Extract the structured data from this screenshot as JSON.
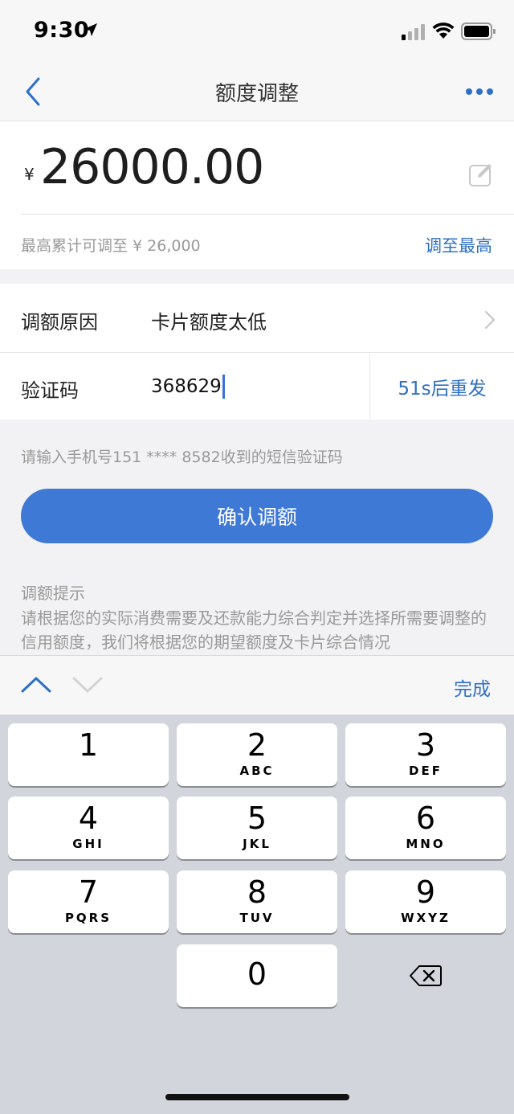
{
  "status_bar": {
    "time": "9:30"
  },
  "nav": {
    "title": "额度调整"
  },
  "amount": {
    "currency": "¥",
    "value": "26000.00",
    "max_hint": "最高累计可调至 ¥ 26,000",
    "adjust_max_label": "调至最高"
  },
  "form": {
    "reason_label": "调额原因",
    "reason_value": "卡片额度太低",
    "code_label": "验证码",
    "code_value": "368629",
    "resend_label": "51s后重发"
  },
  "sms_hint": "请输入手机号151 **** 8582收到的短信验证码",
  "confirm_label": "确认调额",
  "tips": {
    "title": "调额提示",
    "body": "请根据您的实际消费需要及还款能力综合判定并选择所需要调整的信用额度，我们将根据您的期望额度及卡片综合情况"
  },
  "keyboard": {
    "done_label": "完成",
    "keys": [
      {
        "digit": "1",
        "letters": ""
      },
      {
        "digit": "2",
        "letters": "ABC"
      },
      {
        "digit": "3",
        "letters": "DEF"
      },
      {
        "digit": "4",
        "letters": "GHI"
      },
      {
        "digit": "5",
        "letters": "JKL"
      },
      {
        "digit": "6",
        "letters": "MNO"
      },
      {
        "digit": "7",
        "letters": "PQRS"
      },
      {
        "digit": "8",
        "letters": "TUV"
      },
      {
        "digit": "9",
        "letters": "WXYZ"
      },
      {
        "digit": "0",
        "letters": ""
      }
    ]
  },
  "colors": {
    "accent": "#3f79d6",
    "link": "#2f6fc2",
    "keypad_bg": "#d2d5db"
  },
  "icons": [
    "location-arrow-icon",
    "signal-icon",
    "wifi-icon",
    "battery-icon",
    "back-chevron-icon",
    "more-icon",
    "edit-icon",
    "chevron-right-icon",
    "chevron-up-icon",
    "chevron-down-icon",
    "backspace-icon"
  ]
}
